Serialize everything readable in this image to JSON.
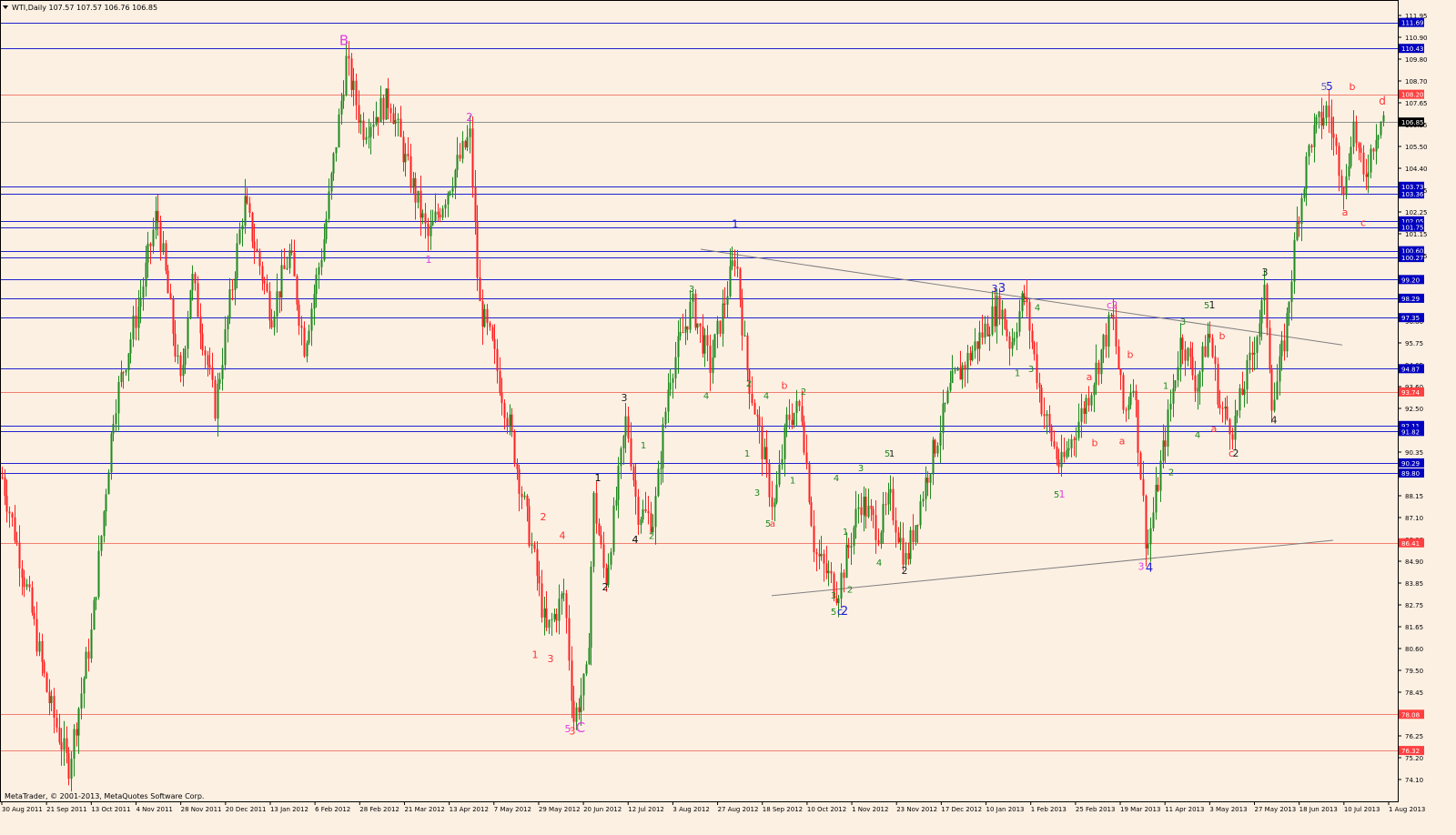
{
  "window": {
    "header": "WTI,Daily  107.57 107.57 106.76 106.85",
    "footer": "MetaTrader, © 2001-2013, MetaQuotes Software Corp."
  },
  "colors": {
    "background": "#fcf0e3",
    "axis": "#000000",
    "bull": "#1f8a1f",
    "bear": "#ff2020",
    "h_line_blue": "#2020d0",
    "h_line_red": "#f08070",
    "trendline": "#808080",
    "price_badge": "#0000c0",
    "price_badge_red": "#ff4040"
  },
  "chart_data": {
    "type": "candlestick",
    "symbol": "WTI",
    "timeframe": "Daily",
    "ylim": [
      73.85,
      112.78
    ],
    "y_ticks": [
      "111.95",
      "110.90",
      "109.80",
      "108.70",
      "107.65",
      "106.55",
      "105.50",
      "104.40",
      "103.35",
      "102.25",
      "101.15",
      "100.05",
      "99.00",
      "97.90",
      "96.80",
      "95.75",
      "94.65",
      "93.60",
      "92.50",
      "91.40",
      "90.35",
      "89.25",
      "88.15",
      "87.10",
      "86.00",
      "84.90",
      "83.85",
      "82.75",
      "81.65",
      "80.60",
      "79.50",
      "78.45",
      "77.35",
      "76.25",
      "75.20",
      "74.10"
    ],
    "x_labels": [
      "30 Aug 2011",
      "21 Sep 2011",
      "13 Oct 2011",
      "4 Nov 2011",
      "28 Nov 2011",
      "20 Dec 2011",
      "13 Jan 2012",
      "6 Feb 2012",
      "28 Feb 2012",
      "21 Mar 2012",
      "13 Apr 2012",
      "7 May 2012",
      "29 May 2012",
      "20 Jun 2012",
      "12 Jul 2012",
      "3 Aug 2012",
      "27 Aug 2012",
      "18 Sep 2012",
      "10 Oct 2012",
      "1 Nov 2012",
      "23 Nov 2012",
      "17 Dec 2012",
      "10 Jan 2013",
      "1 Feb 2013",
      "25 Feb 2013",
      "19 Mar 2013",
      "11 Apr 2013",
      "3 May 2013",
      "27 May 2013",
      "18 Jun 2013",
      "10 Jul 2013",
      "1 Aug 2013"
    ],
    "current_price": 106.85,
    "levels": [
      {
        "price": 111.69,
        "label": "111.69",
        "kind": "blue"
      },
      {
        "price": 110.43,
        "label": "110.43",
        "kind": "blue"
      },
      {
        "price": 108.2,
        "label": "108.20",
        "kind": "red"
      },
      {
        "price": 106.85,
        "label": "106.85",
        "kind": "current"
      },
      {
        "price": 103.73,
        "label": "103.73",
        "kind": "blue"
      },
      {
        "price": 103.36,
        "label": "103.36",
        "kind": "blue"
      },
      {
        "price": 102.05,
        "label": "102.05",
        "kind": "blue"
      },
      {
        "price": 101.75,
        "label": "101.75",
        "kind": "blue"
      },
      {
        "price": 100.6,
        "label": "100.60",
        "kind": "blue"
      },
      {
        "price": 100.27,
        "label": "100.27",
        "kind": "blue"
      },
      {
        "price": 99.2,
        "label": "99.20",
        "kind": "blue"
      },
      {
        "price": 98.29,
        "label": "98.29",
        "kind": "blue"
      },
      {
        "price": 97.35,
        "label": "97.35",
        "kind": "blue"
      },
      {
        "price": 94.87,
        "label": "94.87",
        "kind": "blue"
      },
      {
        "price": 93.74,
        "label": "93.74",
        "kind": "red"
      },
      {
        "price": 92.11,
        "label": "92.11",
        "kind": "blue"
      },
      {
        "price": 91.82,
        "label": "91.82",
        "kind": "blue"
      },
      {
        "price": 90.29,
        "label": "90.29",
        "kind": "blue"
      },
      {
        "price": 89.8,
        "label": "89.80",
        "kind": "blue"
      },
      {
        "price": 86.41,
        "label": "86.41",
        "kind": "red"
      },
      {
        "price": 78.08,
        "label": "78.08",
        "kind": "red"
      },
      {
        "price": 76.32,
        "label": "76.32",
        "kind": "red"
      }
    ],
    "path_points": [
      [
        0,
        90.0
      ],
      [
        30,
        84.0
      ],
      [
        52,
        79.0
      ],
      [
        75,
        75.5
      ],
      [
        100,
        82.0
      ],
      [
        125,
        93.0
      ],
      [
        155,
        98.5
      ],
      [
        172,
        102.5
      ],
      [
        198,
        94.0
      ],
      [
        210,
        99.5
      ],
      [
        236,
        93.0
      ],
      [
        268,
        103.0
      ],
      [
        298,
        97.5
      ],
      [
        318,
        100.5
      ],
      [
        334,
        96.0
      ],
      [
        355,
        101.0
      ],
      [
        368,
        105.5
      ],
      [
        380,
        109.8
      ],
      [
        398,
        106.5
      ],
      [
        428,
        108.0
      ],
      [
        445,
        105.0
      ],
      [
        470,
        101.2
      ],
      [
        495,
        104.0
      ],
      [
        516,
        106.2
      ],
      [
        526,
        98.0
      ],
      [
        540,
        96.0
      ],
      [
        560,
        92.0
      ],
      [
        585,
        86.0
      ],
      [
        600,
        82.0
      ],
      [
        620,
        84.0
      ],
      [
        630,
        77.8
      ],
      [
        645,
        80.0
      ],
      [
        652,
        88.5
      ],
      [
        665,
        84.5
      ],
      [
        688,
        92.5
      ],
      [
        700,
        88.0
      ],
      [
        718,
        87.5
      ],
      [
        735,
        94.5
      ],
      [
        760,
        98.0
      ],
      [
        780,
        95.0
      ],
      [
        808,
        100.5
      ],
      [
        820,
        95.0
      ],
      [
        850,
        88.0
      ],
      [
        865,
        92.5
      ],
      [
        880,
        93.0
      ],
      [
        895,
        86.0
      ],
      [
        920,
        84.0
      ],
      [
        945,
        88.5
      ],
      [
        965,
        87.0
      ],
      [
        978,
        88.5
      ],
      [
        995,
        85.5
      ],
      [
        1020,
        90.0
      ],
      [
        1045,
        94.0
      ],
      [
        1098,
        98.0
      ],
      [
        1110,
        96.0
      ],
      [
        1125,
        98.5
      ],
      [
        1145,
        93.0
      ],
      [
        1165,
        90.0
      ],
      [
        1195,
        93.5
      ],
      [
        1222,
        97.5
      ],
      [
        1235,
        92.5
      ],
      [
        1245,
        94.5
      ],
      [
        1260,
        86.0
      ],
      [
        1280,
        91.5
      ],
      [
        1298,
        96.5
      ],
      [
        1315,
        94.0
      ],
      [
        1328,
        96.8
      ],
      [
        1340,
        93.0
      ],
      [
        1355,
        92.0
      ],
      [
        1375,
        95.5
      ],
      [
        1390,
        98.5
      ],
      [
        1398,
        93.0
      ],
      [
        1412,
        96.5
      ],
      [
        1425,
        102.0
      ],
      [
        1440,
        106.0
      ],
      [
        1458,
        107.5
      ],
      [
        1465,
        106.0
      ],
      [
        1478,
        103.5
      ],
      [
        1486,
        107.0
      ],
      [
        1498,
        104.0
      ],
      [
        1512,
        106.5
      ],
      [
        1520,
        107.2
      ]
    ],
    "trendlines": [
      {
        "from": [
          770,
          100.67
        ],
        "to": [
          1475,
          96.02
        ]
      },
      {
        "from": [
          848,
          83.84
        ],
        "to": [
          1465,
          86.53
        ]
      }
    ],
    "annotations": [
      {
        "t": "B",
        "x": 378,
        "y": 110.6,
        "c": "#e040e0",
        "s": 15
      },
      {
        "t": "2",
        "x": 516,
        "y": 106.9,
        "c": "#e040e0",
        "s": 12
      },
      {
        "t": "1",
        "x": 471,
        "y": 100.0,
        "c": "#e040e0",
        "s": 11
      },
      {
        "t": "2",
        "x": 597,
        "y": 87.5,
        "c": "#ff3030",
        "s": 11
      },
      {
        "t": "4",
        "x": 618,
        "y": 86.6,
        "c": "#ff3030",
        "s": 11
      },
      {
        "t": "1",
        "x": 588,
        "y": 80.8,
        "c": "#ff3030",
        "s": 11
      },
      {
        "t": "3",
        "x": 605,
        "y": 80.6,
        "c": "#ff3030",
        "s": 11
      },
      {
        "t": "5",
        "x": 624,
        "y": 77.2,
        "c": "#e040e0",
        "s": 11
      },
      {
        "t": "3",
        "x": 629,
        "y": 77.1,
        "c": "#ff3030",
        "s": 11
      },
      {
        "t": "C",
        "x": 638,
        "y": 77.2,
        "c": "#e040e0",
        "s": 15
      },
      {
        "t": "1",
        "x": 657,
        "y": 89.4,
        "c": "#000000",
        "s": 11
      },
      {
        "t": "2",
        "x": 665,
        "y": 84.1,
        "c": "#202020",
        "s": 11
      },
      {
        "t": "3",
        "x": 686,
        "y": 93.3,
        "c": "#202020",
        "s": 11
      },
      {
        "t": "4",
        "x": 698,
        "y": 86.4,
        "c": "#000000",
        "s": 11
      },
      {
        "t": "1",
        "x": 707,
        "y": 91.0,
        "c": "#1f8a1f",
        "s": 10
      },
      {
        "t": "2",
        "x": 716,
        "y": 86.6,
        "c": "#1f8a1f",
        "s": 10
      },
      {
        "t": "3",
        "x": 760,
        "y": 98.6,
        "c": "#1f8a1f",
        "s": 10
      },
      {
        "t": "4",
        "x": 776,
        "y": 93.4,
        "c": "#1f8a1f",
        "s": 10
      },
      {
        "t": "1",
        "x": 808,
        "y": 101.7,
        "c": "#2020d0",
        "s": 12
      },
      {
        "t": "2",
        "x": 823,
        "y": 94.0,
        "c": "#1f8a1f",
        "s": 10
      },
      {
        "t": "1",
        "x": 821,
        "y": 90.6,
        "c": "#1f8a1f",
        "s": 10
      },
      {
        "t": "3",
        "x": 832,
        "y": 88.7,
        "c": "#1f8a1f",
        "s": 10
      },
      {
        "t": "4",
        "x": 842,
        "y": 93.4,
        "c": "#1f8a1f",
        "s": 10
      },
      {
        "t": "b",
        "x": 862,
        "y": 93.9,
        "c": "#ff3030",
        "s": 11
      },
      {
        "t": "2",
        "x": 883,
        "y": 93.6,
        "c": "#1f8a1f",
        "s": 10
      },
      {
        "t": "1",
        "x": 871,
        "y": 89.3,
        "c": "#1f8a1f",
        "s": 10
      },
      {
        "t": "5",
        "x": 844,
        "y": 87.2,
        "c": "#1f8a1f",
        "s": 10
      },
      {
        "t": "a",
        "x": 849,
        "y": 87.2,
        "c": "#ff3030",
        "s": 10
      },
      {
        "t": "4",
        "x": 919,
        "y": 89.4,
        "c": "#1f8a1f",
        "s": 10
      },
      {
        "t": "3",
        "x": 946,
        "y": 89.9,
        "c": "#1f8a1f",
        "s": 10
      },
      {
        "t": "1",
        "x": 929,
        "y": 86.8,
        "c": "#1f8a1f",
        "s": 10
      },
      {
        "t": "2",
        "x": 934,
        "y": 84.0,
        "c": "#1f8a1f",
        "s": 10
      },
      {
        "t": "3",
        "x": 916,
        "y": 83.7,
        "c": "#1f8a1f",
        "s": 10
      },
      {
        "t": "5",
        "x": 916,
        "y": 82.9,
        "c": "#1f8a1f",
        "s": 10
      },
      {
        "t": "c",
        "x": 923,
        "y": 82.9,
        "c": "#2020d0",
        "s": 11
      },
      {
        "t": "2",
        "x": 928,
        "y": 82.9,
        "c": "#2020d0",
        "s": 13
      },
      {
        "t": "5",
        "x": 975,
        "y": 90.6,
        "c": "#1f8a1f",
        "s": 10
      },
      {
        "t": "1",
        "x": 980,
        "y": 90.6,
        "c": "#202020",
        "s": 10
      },
      {
        "t": "4",
        "x": 966,
        "y": 85.3,
        "c": "#1f8a1f",
        "s": 10
      },
      {
        "t": "2",
        "x": 994,
        "y": 84.9,
        "c": "#202020",
        "s": 11
      },
      {
        "t": "3",
        "x": 1093,
        "y": 98.6,
        "c": "#2020d0",
        "s": 11
      },
      {
        "t": "3",
        "x": 1101,
        "y": 98.6,
        "c": "#2020d0",
        "s": 13
      },
      {
        "t": "2",
        "x": 1125,
        "y": 98.1,
        "c": "#1f8a1f",
        "s": 10
      },
      {
        "t": "4",
        "x": 1140,
        "y": 97.7,
        "c": "#1f8a1f",
        "s": 10
      },
      {
        "t": "1",
        "x": 1118,
        "y": 94.5,
        "c": "#1f8a1f",
        "s": 10
      },
      {
        "t": "3",
        "x": 1133,
        "y": 94.7,
        "c": "#1f8a1f",
        "s": 10
      },
      {
        "t": "5",
        "x": 1161,
        "y": 88.6,
        "c": "#1f8a1f",
        "s": 10
      },
      {
        "t": "1",
        "x": 1167,
        "y": 88.6,
        "c": "#e040e0",
        "s": 11
      },
      {
        "t": "a",
        "x": 1197,
        "y": 94.3,
        "c": "#ff3030",
        "s": 11
      },
      {
        "t": "b",
        "x": 1203,
        "y": 91.1,
        "c": "#ff3030",
        "s": 11
      },
      {
        "t": "c",
        "x": 1219,
        "y": 97.8,
        "c": "#e040e0",
        "s": 11
      },
      {
        "t": "2",
        "x": 1225,
        "y": 97.8,
        "c": "#e040e0",
        "s": 11
      },
      {
        "t": "b",
        "x": 1242,
        "y": 95.4,
        "c": "#ff3030",
        "s": 11
      },
      {
        "t": "a",
        "x": 1233,
        "y": 91.2,
        "c": "#ff3030",
        "s": 11
      },
      {
        "t": "3",
        "x": 1254,
        "y": 85.1,
        "c": "#e040e0",
        "s": 11
      },
      {
        "t": "4",
        "x": 1263,
        "y": 85.0,
        "c": "#2020d0",
        "s": 13
      },
      {
        "t": "1",
        "x": 1281,
        "y": 93.9,
        "c": "#1f8a1f",
        "s": 10
      },
      {
        "t": "2",
        "x": 1287,
        "y": 89.7,
        "c": "#1f8a1f",
        "s": 10
      },
      {
        "t": "3",
        "x": 1300,
        "y": 97.0,
        "c": "#1f8a1f",
        "s": 10
      },
      {
        "t": "4",
        "x": 1316,
        "y": 91.5,
        "c": "#1f8a1f",
        "s": 10
      },
      {
        "t": "5",
        "x": 1326,
        "y": 97.8,
        "c": "#1f8a1f",
        "s": 10
      },
      {
        "t": "1",
        "x": 1332,
        "y": 97.8,
        "c": "#202020",
        "s": 11
      },
      {
        "t": "b",
        "x": 1343,
        "y": 96.3,
        "c": "#ff3030",
        "s": 11
      },
      {
        "t": "a",
        "x": 1334,
        "y": 91.8,
        "c": "#ff3030",
        "s": 11
      },
      {
        "t": "c",
        "x": 1353,
        "y": 90.6,
        "c": "#ff3030",
        "s": 11
      },
      {
        "t": "2",
        "x": 1358,
        "y": 90.6,
        "c": "#202020",
        "s": 11
      },
      {
        "t": "3",
        "x": 1390,
        "y": 99.4,
        "c": "#202020",
        "s": 11
      },
      {
        "t": "4",
        "x": 1400,
        "y": 92.2,
        "c": "#202020",
        "s": 11
      },
      {
        "t": "5",
        "x": 1455,
        "y": 108.4,
        "c": "#6060c0",
        "s": 11
      },
      {
        "t": "5",
        "x": 1461,
        "y": 108.4,
        "c": "#2020d0",
        "s": 12
      },
      {
        "t": "b",
        "x": 1486,
        "y": 108.4,
        "c": "#ff3030",
        "s": 11
      },
      {
        "t": "d",
        "x": 1519,
        "y": 107.7,
        "c": "#ff3030",
        "s": 12
      },
      {
        "t": "a",
        "x": 1478,
        "y": 102.3,
        "c": "#ff3030",
        "s": 11
      },
      {
        "t": "c",
        "x": 1498,
        "y": 101.8,
        "c": "#ff3030",
        "s": 11
      }
    ]
  }
}
